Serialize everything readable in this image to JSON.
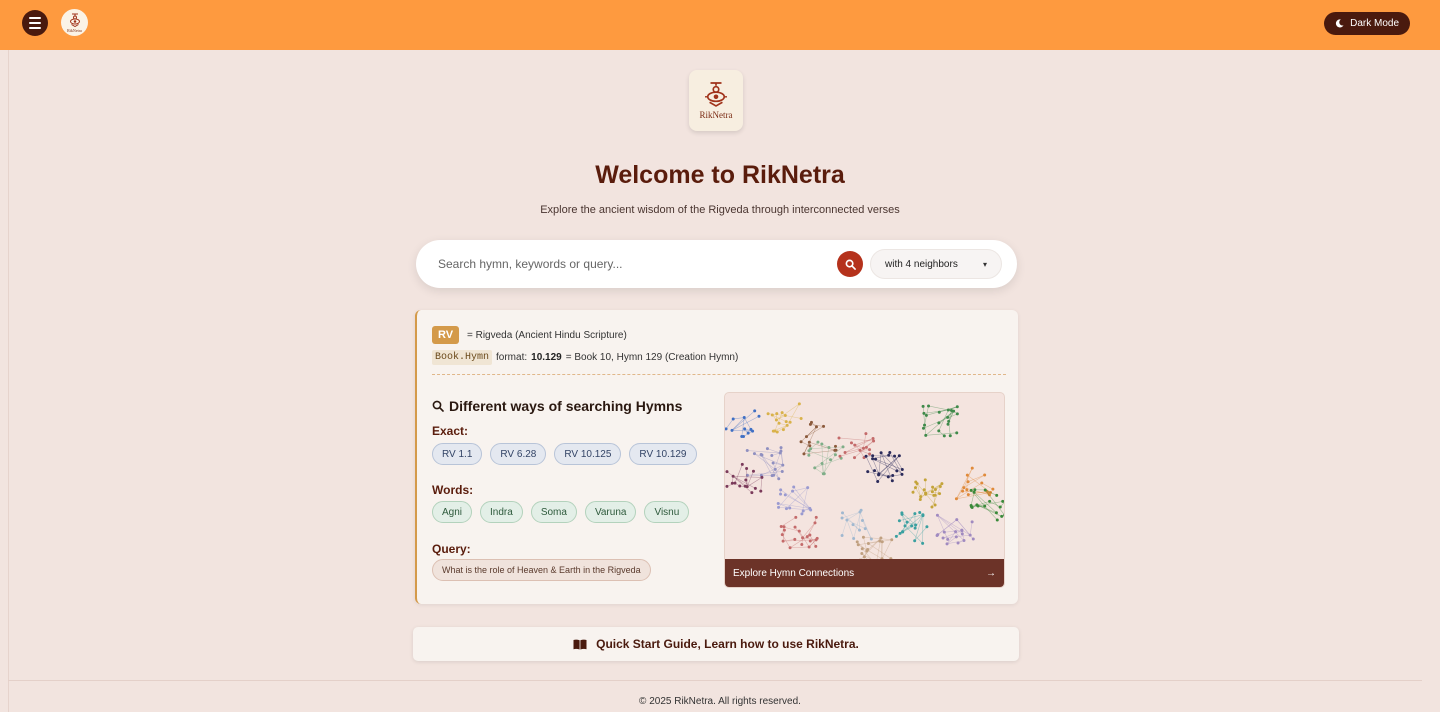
{
  "topbar": {
    "logo_text": "RikNetra",
    "dark_mode_label": "Dark Mode",
    "dark_mode_icon": "moon-icon",
    "menu_icon": "hamburger-icon"
  },
  "hero": {
    "logo_text": "RikNetra",
    "title": "Welcome to RikNetra",
    "subtitle": "Explore the ancient wisdom of the Rigveda through interconnected verses"
  },
  "search": {
    "placeholder": "Search hymn, keywords or query...",
    "value": "",
    "button_icon": "search-icon",
    "neighbors_selected": "with 4 neighbors"
  },
  "info": {
    "rv_badge": "RV",
    "rv_desc": "= Rigveda (Ancient Hindu Scripture)",
    "format_code": "Book.Hymn",
    "format_prefix": "format:",
    "format_example": "10.129",
    "format_desc": "= Book 10, Hymn 129 (Creation Hymn)",
    "ways_title": "Different ways of searching Hymns",
    "exact_label": "Exact:",
    "exact_chips": [
      "RV 1.1",
      "RV 6.28",
      "RV 10.125",
      "RV 10.129"
    ],
    "words_label": "Words:",
    "word_chips": [
      "Agni",
      "Indra",
      "Soma",
      "Varuna",
      "Visnu"
    ],
    "query_label": "Query:",
    "query_chip": "What is the role of Heaven & Earth in the Rigveda",
    "graph_cta": "Explore Hymn Connections",
    "graph_arrow": "→"
  },
  "guide": {
    "label": "Quick Start Guide, Learn how to use RikNetra.",
    "icon": "book-icon"
  },
  "footer": {
    "copyright": "© 2025 RikNetra. All rights reserved."
  },
  "colors": {
    "topbar": "#fe9a3f",
    "background": "#f2e4df",
    "accent_dark": "#4a1a0e",
    "search_button": "#b5321c",
    "graph_footer": "#6c3328"
  }
}
